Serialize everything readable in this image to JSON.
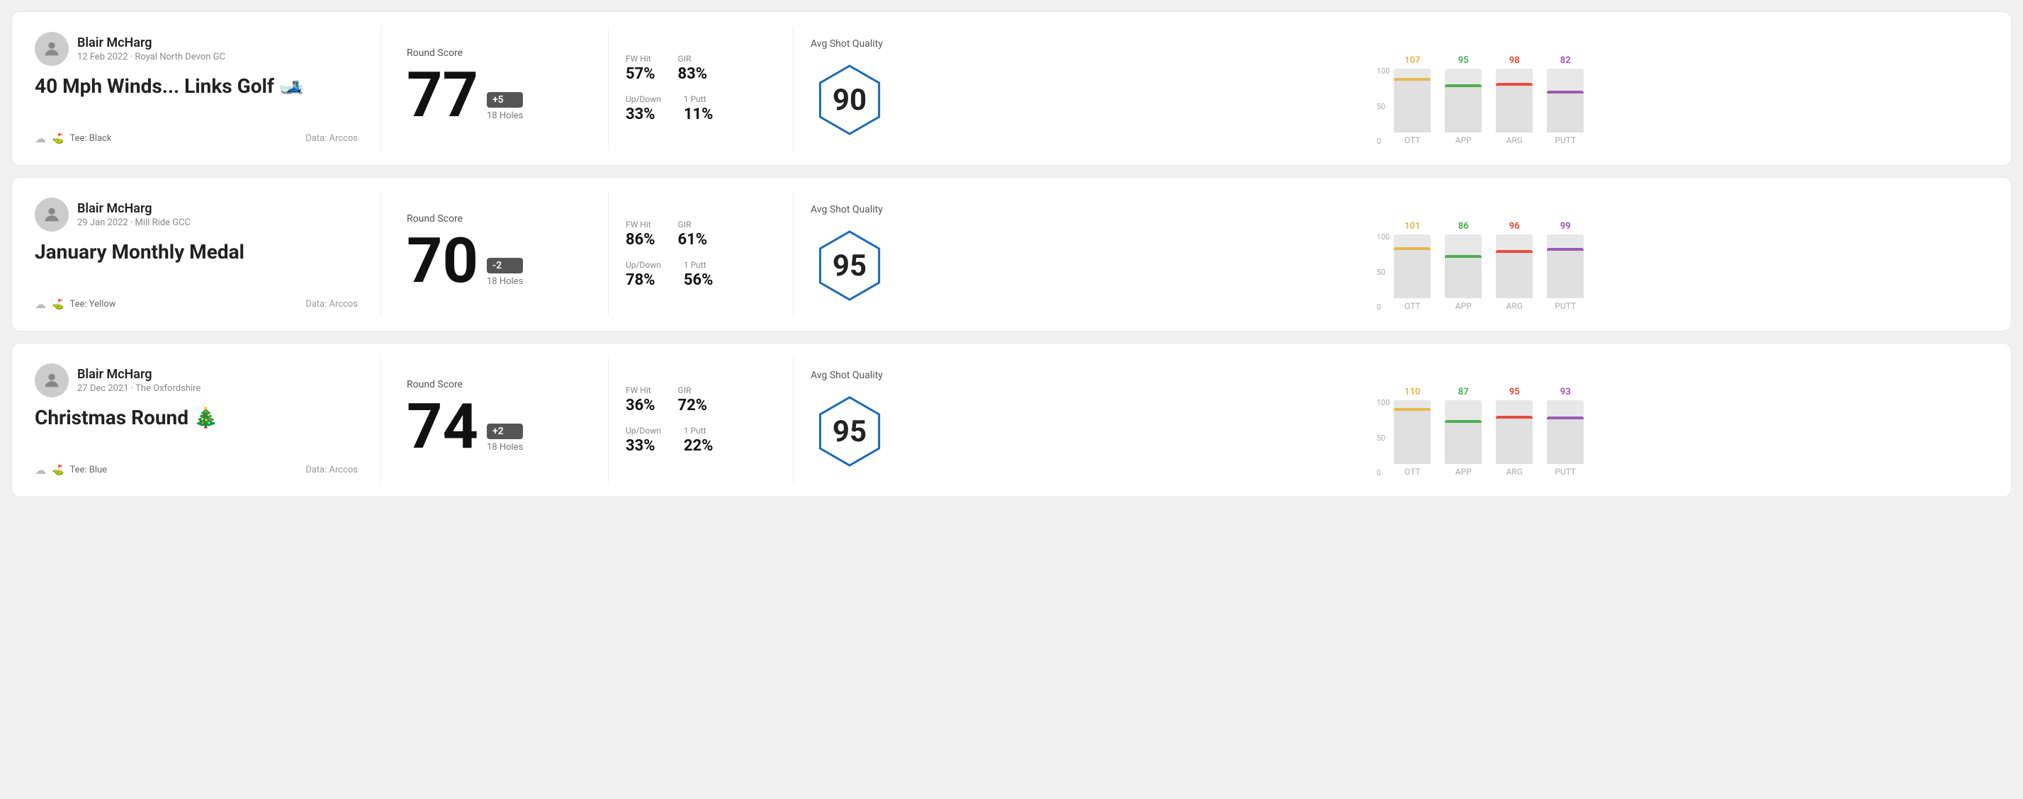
{
  "rounds": [
    {
      "id": "round1",
      "user": {
        "name": "Blair McHarg",
        "date_course": "12 Feb 2022 · Royal North Devon GC"
      },
      "title": "40 Mph Winds... Links Golf 🎿",
      "tee": "Black",
      "data_source": "Data: Arccos",
      "score": "77",
      "score_modifier": "+5",
      "modifier_type": "plus",
      "holes": "18 Holes",
      "fw_hit": "57%",
      "gir": "83%",
      "up_down": "33%",
      "one_putt": "11%",
      "avg_quality": "90",
      "chart": {
        "bars": [
          {
            "label": "OTT",
            "value": 107,
            "color": "#e8b84b",
            "height_pct": 85
          },
          {
            "label": "APP",
            "value": 95,
            "color": "#4caf50",
            "height_pct": 75
          },
          {
            "label": "ARG",
            "value": 98,
            "color": "#e74c3c",
            "height_pct": 78
          },
          {
            "label": "PUTT",
            "value": 82,
            "color": "#9b59b6",
            "height_pct": 65
          }
        ]
      }
    },
    {
      "id": "round2",
      "user": {
        "name": "Blair McHarg",
        "date_course": "29 Jan 2022 · Mill Ride GCC"
      },
      "title": "January Monthly Medal",
      "tee": "Yellow",
      "data_source": "Data: Arccos",
      "score": "70",
      "score_modifier": "-2",
      "modifier_type": "minus",
      "holes": "18 Holes",
      "fw_hit": "86%",
      "gir": "61%",
      "up_down": "78%",
      "one_putt": "56%",
      "avg_quality": "95",
      "chart": {
        "bars": [
          {
            "label": "OTT",
            "value": 101,
            "color": "#e8b84b",
            "height_pct": 80
          },
          {
            "label": "APP",
            "value": 86,
            "color": "#4caf50",
            "height_pct": 68
          },
          {
            "label": "ARG",
            "value": 96,
            "color": "#e74c3c",
            "height_pct": 76
          },
          {
            "label": "PUTT",
            "value": 99,
            "color": "#9b59b6",
            "height_pct": 79
          }
        ]
      }
    },
    {
      "id": "round3",
      "user": {
        "name": "Blair McHarg",
        "date_course": "27 Dec 2021 · The Oxfordshire"
      },
      "title": "Christmas Round 🎄",
      "tee": "Blue",
      "data_source": "Data: Arccos",
      "score": "74",
      "score_modifier": "+2",
      "modifier_type": "plus",
      "holes": "18 Holes",
      "fw_hit": "36%",
      "gir": "72%",
      "up_down": "33%",
      "one_putt": "22%",
      "avg_quality": "95",
      "chart": {
        "bars": [
          {
            "label": "OTT",
            "value": 110,
            "color": "#e8b84b",
            "height_pct": 88
          },
          {
            "label": "APP",
            "value": 87,
            "color": "#4caf50",
            "height_pct": 69
          },
          {
            "label": "ARG",
            "value": 95,
            "color": "#e74c3c",
            "height_pct": 75
          },
          {
            "label": "PUTT",
            "value": 93,
            "color": "#9b59b6",
            "height_pct": 74
          }
        ]
      }
    }
  ],
  "labels": {
    "round_score": "Round Score",
    "fw_hit": "FW Hit",
    "gir": "GIR",
    "up_down": "Up/Down",
    "one_putt": "1 Putt",
    "avg_quality": "Avg Shot Quality",
    "tee_prefix": "Tee:",
    "data_arccos": "Data: Arccos",
    "y_axis": [
      "100",
      "50",
      "0"
    ]
  }
}
